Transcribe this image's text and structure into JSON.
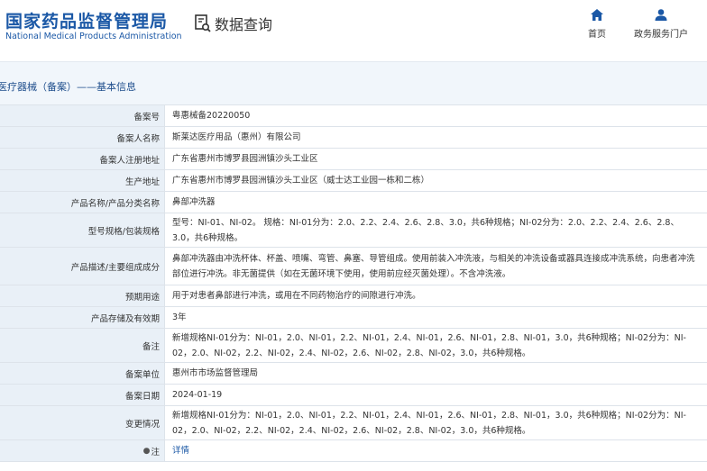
{
  "header": {
    "logo_cn": "国家药品监督管理局",
    "logo_en": "National Medical Products Administration",
    "page_title": "数据查询",
    "nav": [
      {
        "label": "首页",
        "icon": "home-icon"
      },
      {
        "label": "政务服务门户",
        "icon": "user-icon"
      }
    ]
  },
  "breadcrumb": "医疗器械（备案）——基本信息",
  "colors": {
    "brand_blue": "#1b58a6",
    "label_bg": "#e9f0f7",
    "border": "#dde3ea"
  },
  "record": [
    {
      "label": "备案号",
      "value": "粤惠械备20220050"
    },
    {
      "label": "备案人名称",
      "value": "斯莱达医疗用品（惠州）有限公司"
    },
    {
      "label": "备案人注册地址",
      "value": "广东省惠州市博罗县园洲镇沙头工业区"
    },
    {
      "label": "生产地址",
      "value": "广东省惠州市博罗县园洲镇沙头工业区（威士达工业园一栋和二栋）"
    },
    {
      "label": "产品名称/产品分类名称",
      "value": "鼻部冲洗器"
    },
    {
      "label": "型号规格/包装规格",
      "value": "型号：NI-01、NI-02。 规格：NI-01分为：2.0、2.2、2.4、2.6、2.8、3.0，共6种规格；NI-02分为：2.0、2.2、2.4、2.6、2.8、3.0，共6种规格。"
    },
    {
      "label": "产品描述/主要组成成分",
      "value": "鼻部冲洗器由冲洗杯体、杯盖、喷嘴、弯管、鼻塞、导管组成。使用前装入冲洗液，与相关的冲洗设备或器具连接成冲洗系统，向患者冲洗部位进行冲洗。非无菌提供（如在无菌环境下使用，使用前应经灭菌处理）。不含冲洗液。"
    },
    {
      "label": "预期用途",
      "value": "用于对患者鼻部进行冲洗，或用在不同药物治疗的间隙进行冲洗。"
    },
    {
      "label": "产品存储及有效期",
      "value": "3年"
    },
    {
      "label": "备注",
      "value": "新增规格NI-01分为：NI-01，2.0、NI-01，2.2、NI-01，2.4、NI-01，2.6、NI-01，2.8、NI-01，3.0，共6种规格；NI-02分为：NI-02，2.0、NI-02，2.2、NI-02，2.4、NI-02，2.6、NI-02，2.8、NI-02，3.0，共6种规格。"
    },
    {
      "label": "备案单位",
      "value": "惠州市市场监督管理局"
    },
    {
      "label": "备案日期",
      "value": "2024-01-19"
    },
    {
      "label": "变更情况",
      "value": "新增规格NI-01分为：NI-01，2.0、NI-01，2.2、NI-01，2.4、NI-01，2.6、NI-01，2.8、NI-01，3.0，共6种规格；NI-02分为：NI-02，2.0、NI-02，2.2、NI-02，2.4、NI-02，2.6、NI-02，2.8、NI-02，3.0，共6种规格。"
    },
    {
      "label": "注",
      "value": "详情"
    }
  ]
}
